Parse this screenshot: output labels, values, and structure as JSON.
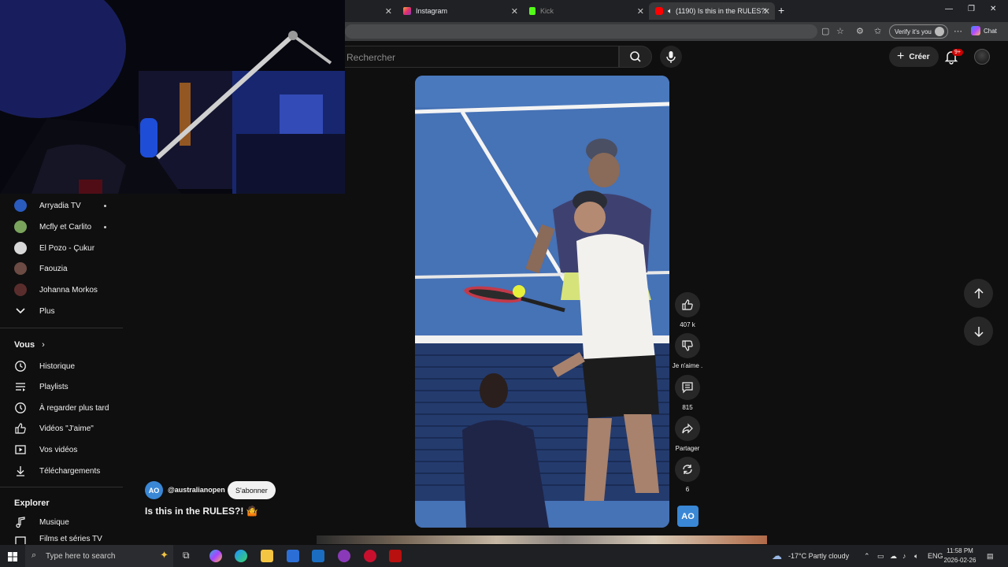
{
  "browser": {
    "tabs": [
      {
        "title": "Instagram",
        "state": "inactive"
      },
      {
        "title": "Kick",
        "state": "inactive-dim"
      },
      {
        "title": "(1190) Is this in the RULES?! ",
        "state": "active"
      }
    ],
    "verify_label": "Verify it's you",
    "copilot_label": "Chat"
  },
  "youtube": {
    "search_placeholder": "Rechercher",
    "create_label": "Créer",
    "notification_count": "9+"
  },
  "sidebar": {
    "subscriptions": [
      {
        "name": "Arryadia TV",
        "avatar_color": "#2a5bbf",
        "new": true
      },
      {
        "name": "Mcfly et Carlito",
        "avatar_color": "#7aa35c",
        "new": true
      },
      {
        "name": "El Pozo - Çukur",
        "avatar_color": "#d8d8d8",
        "new": false
      },
      {
        "name": "Faouzia",
        "avatar_color": "#6b4b43",
        "new": false
      },
      {
        "name": "Johanna Morkos",
        "avatar_color": "#5a2d2d",
        "new": false
      }
    ],
    "more_label": "Plus",
    "you_section": "Vous",
    "you_items": [
      {
        "label": "Historique",
        "icon": "history-icon"
      },
      {
        "label": "Playlists",
        "icon": "playlists-icon"
      },
      {
        "label": "À regarder plus tard",
        "icon": "watch-later-icon"
      },
      {
        "label": "Vidéos \"J'aime\"",
        "icon": "liked-icon"
      },
      {
        "label": "Vos vidéos",
        "icon": "your-videos-icon"
      },
      {
        "label": "Téléchargements",
        "icon": "downloads-icon"
      }
    ],
    "explore_section": "Explorer",
    "explore_items": [
      {
        "label": "Musique",
        "icon": "music-icon"
      },
      {
        "label": "Films et séries TV",
        "icon": "movies-icon"
      }
    ]
  },
  "short": {
    "channel_handle": "@australianopen",
    "channel_logo": "AO",
    "subscribe_label": "S'abonner",
    "title": "Is this in the RULES?! 🤷",
    "likes": "407 k",
    "dislike_label": "Je n'aime .",
    "comments": "815",
    "share_label": "Partager",
    "remix_count": "6"
  },
  "taskbar": {
    "search_placeholder": "Type here to search",
    "weather": "-17°C  Partly cloudy",
    "language": "ENG",
    "time": "11:58 PM",
    "date": "2026-02-26"
  },
  "colors": {
    "youtube_bg": "#0f0f0f",
    "court_blue": "#3f6cb0",
    "ao_blue": "#3a87d6",
    "badge_red": "#cc0000"
  }
}
